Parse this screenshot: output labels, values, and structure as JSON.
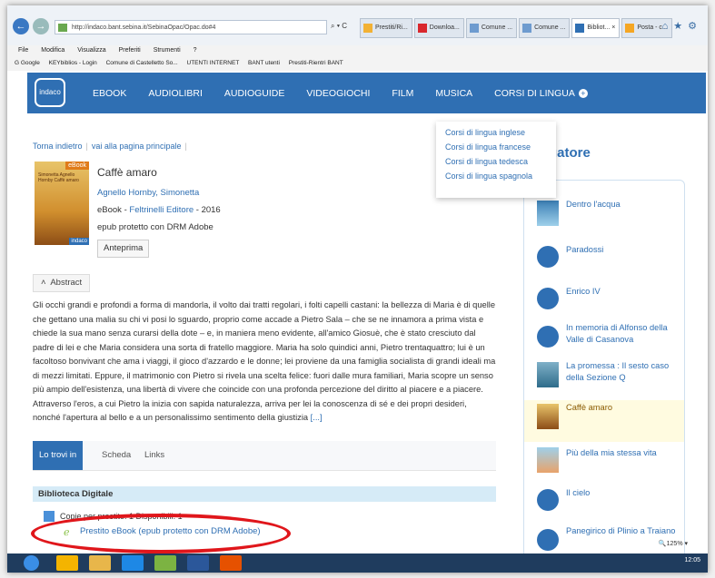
{
  "browser": {
    "url": "http://indaco.bant.sebina.it/SebinaOpac/Opac.do#4",
    "url_tools": "⌕ ▾ C",
    "tabs": [
      "Prestiti/Ri...",
      "Downloa...",
      "Comune ...",
      "Comune ...",
      "Bibliot... ×",
      "Posta - c..."
    ],
    "menu": [
      "File",
      "Modifica",
      "Visualizza",
      "Preferiti",
      "Strumenti",
      "?"
    ],
    "favorites": [
      "G Google",
      "KEYbiblios - Login",
      "Comune di Castelletto So...",
      "UTENTI INTERNET",
      "BANT utenti",
      "Prestiti-Rientri BANT"
    ],
    "zoom": "🔍125%  ▾",
    "clock": "12:05"
  },
  "nav": {
    "logo": "indaco",
    "items": [
      "EBOOK",
      "AUDIOLIBRI",
      "AUDIOGUIDE",
      "VIDEOGIOCHI",
      "FILM",
      "MUSICA",
      "CORSI DI LINGUA"
    ]
  },
  "dropdown": {
    "items": [
      "Corsi di lingua inglese",
      "Corsi di lingua francese",
      "Corsi di lingua tedesca",
      "Corsi di lingua spagnola"
    ]
  },
  "breadcrumb": {
    "back": "Torna indietro",
    "home": "vai alla pagina principale"
  },
  "book": {
    "cover_badge": "eBook",
    "cover_text": "Simonetta Agnello Hornby Caffè amaro",
    "cover_publisher": "indaco",
    "title": "Caffè amaro",
    "author": "Agnello Hornby, Simonetta",
    "format_prefix": "eBook - ",
    "publisher": "Feltrinelli Editore",
    "year": " - 2016",
    "drm": "epub protetto con DRM Adobe",
    "preview": "Anteprima"
  },
  "abstract": {
    "button": "Abstract",
    "text": "Gli occhi grandi e profondi a forma di mandorla, il volto dai tratti regolari, i folti capelli castani: la bellezza di Maria è di quelle che gettano una malia su chi vi posi lo sguardo, proprio come accade a Pietro Sala – che se ne innamora a prima vista e chiede la sua mano senza curarsi della dote – e, in maniera meno evidente, all'amico Giosuè, che è stato cresciuto dal padre di lei e che Maria considera una sorta di fratello maggiore. Maria ha solo quindici anni, Pietro trentaquattro; lui è un facoltoso bonvivant che ama i viaggi, il gioco d'azzardo e le donne; lei proviene da una famiglia socialista di grandi ideali ma di mezzi limitati. Eppure, il matrimonio con Pietro si rivela una scelta felice: fuori dalle mura familiari, Maria scopre un senso più ampio dell'esistenza, una libertà di vivere che coincide con una profonda percezione del diritto al piacere e a piacere. Attraverso l'eros, a cui Pietro la inizia con sapida naturalezza, arriva per lei la conoscenza di sé e dei propri desideri, nonché l'apertura al bello e a un personalissimo sentimento della giustizia ",
    "more": "[...]"
  },
  "detail_tabs": [
    "Lo trovi in",
    "Scheda",
    "Links"
  ],
  "library": {
    "name": "Biblioteca Digitale",
    "copies": "Copie per prestito: 1  Disponibili: 1",
    "lend_link": "Prestito eBook (epub protetto con DRM Adobe)"
  },
  "sidebar": {
    "title": "gatore",
    "items": [
      "Dentro l'acqua",
      "Paradossi",
      "Enrico IV",
      "In memoria di Alfonso della Valle di Casanova",
      "La promessa : Il sesto caso della Sezione Q",
      "Caffè amaro",
      "Più della mia stessa vita",
      "Il cielo",
      "Panegirico di Plinio a Traiano"
    ]
  },
  "colors": {
    "brand": "#2f6fb3",
    "highlight_ellipse": "#e0161b"
  }
}
